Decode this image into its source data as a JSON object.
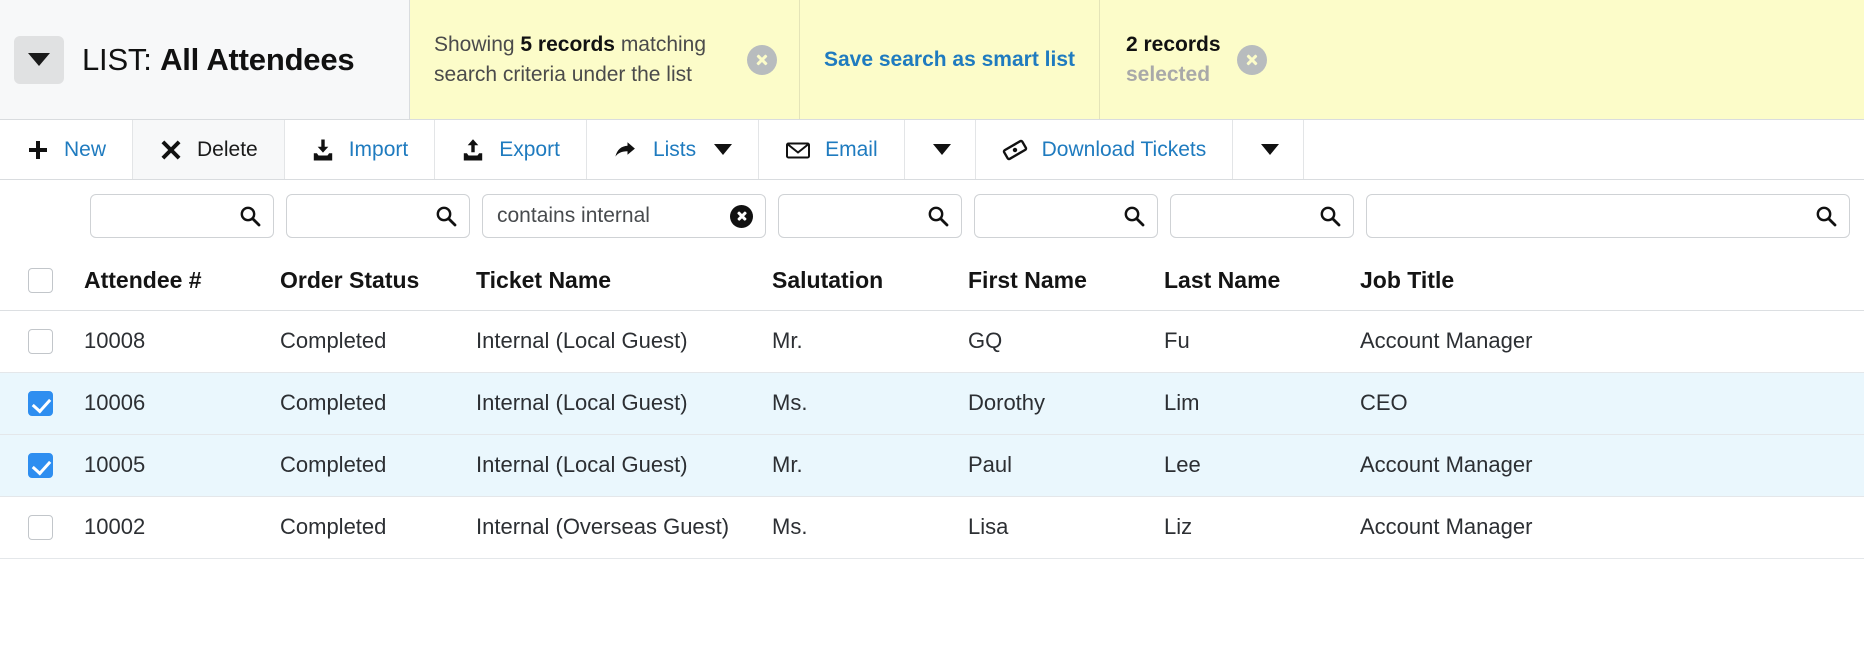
{
  "header": {
    "list_label": "LIST:",
    "list_name": "All Attendees",
    "caret_icon": "chevron-down-icon",
    "banner": {
      "showing_prefix": "Showing",
      "showing_count": "5 records",
      "showing_suffix": "matching search criteria under the list",
      "dismiss_icon": "close-circle-icon",
      "save_search_link": "Save search as smart list",
      "selected_count": "2 records",
      "selected_word": "selected",
      "selected_dismiss_icon": "close-circle-icon",
      "background_color": "#fcfcc9",
      "link_color": "#1f7bbf"
    }
  },
  "toolbar": {
    "buttons": [
      {
        "label": "New",
        "icon": "plus-icon",
        "has_caret": false,
        "label_color": "blue"
      },
      {
        "label": "Delete",
        "icon": "cross-icon",
        "has_caret": false,
        "label_color": "dark"
      },
      {
        "label": "Import",
        "icon": "import-download-icon",
        "has_caret": false,
        "label_color": "blue"
      },
      {
        "label": "Export",
        "icon": "export-upload-icon",
        "has_caret": false,
        "label_color": "blue"
      },
      {
        "label": "Lists",
        "icon": "share-arrow-icon",
        "has_caret": true,
        "label_color": "blue"
      },
      {
        "label": "Email",
        "icon": "envelope-icon",
        "has_caret": false,
        "label_color": "blue"
      },
      {
        "label": "Download Tickets",
        "icon": "ticket-icon",
        "has_caret": false,
        "label_color": "blue"
      }
    ],
    "email_dropdown_icon": "chevron-down-icon",
    "tickets_dropdown_icon": "chevron-down-icon"
  },
  "filters": [
    {
      "value": "",
      "placeholder": "",
      "has_clear": false,
      "search_icon": "search-icon"
    },
    {
      "value": "",
      "placeholder": "",
      "has_clear": false,
      "search_icon": "search-icon"
    },
    {
      "value": "contains internal",
      "placeholder": "",
      "has_clear": true,
      "clear_icon": "clear-circle-icon"
    },
    {
      "value": "",
      "placeholder": "",
      "has_clear": false,
      "search_icon": "search-icon"
    },
    {
      "value": "",
      "placeholder": "",
      "has_clear": false,
      "search_icon": "search-icon"
    },
    {
      "value": "",
      "placeholder": "",
      "has_clear": false,
      "search_icon": "search-icon"
    },
    {
      "value": "",
      "placeholder": "",
      "has_clear": false,
      "search_icon": "search-icon"
    }
  ],
  "table": {
    "select_all_checked": false,
    "columns": [
      "Attendee #",
      "Order Status",
      "Ticket Name",
      "Salutation",
      "First Name",
      "Last Name",
      "Job Title"
    ],
    "rows": [
      {
        "selected": false,
        "attendee_number": "10008",
        "order_status": "Completed",
        "ticket_name": "Internal (Local Guest)",
        "salutation": "Mr.",
        "first_name": "GQ",
        "last_name": "Fu",
        "job_title": "Account Manager"
      },
      {
        "selected": true,
        "attendee_number": "10006",
        "order_status": "Completed",
        "ticket_name": "Internal (Local Guest)",
        "salutation": "Ms.",
        "first_name": "Dorothy",
        "last_name": "Lim",
        "job_title": "CEO"
      },
      {
        "selected": true,
        "attendee_number": "10005",
        "order_status": "Completed",
        "ticket_name": "Internal (Local Guest)",
        "salutation": "Mr.",
        "first_name": "Paul",
        "last_name": "Lee",
        "job_title": "Account Manager"
      },
      {
        "selected": false,
        "attendee_number": "10002",
        "order_status": "Completed",
        "ticket_name": "Internal (Overseas Guest)",
        "salutation": "Ms.",
        "first_name": "Lisa",
        "last_name": "Liz",
        "job_title": "Account Manager"
      }
    ]
  },
  "colors": {
    "accent_blue": "#1f7bbf",
    "checkbox_blue": "#2e8ef0",
    "selected_row": "#eaf7fd",
    "banner_yellow": "#fcfcc9"
  }
}
